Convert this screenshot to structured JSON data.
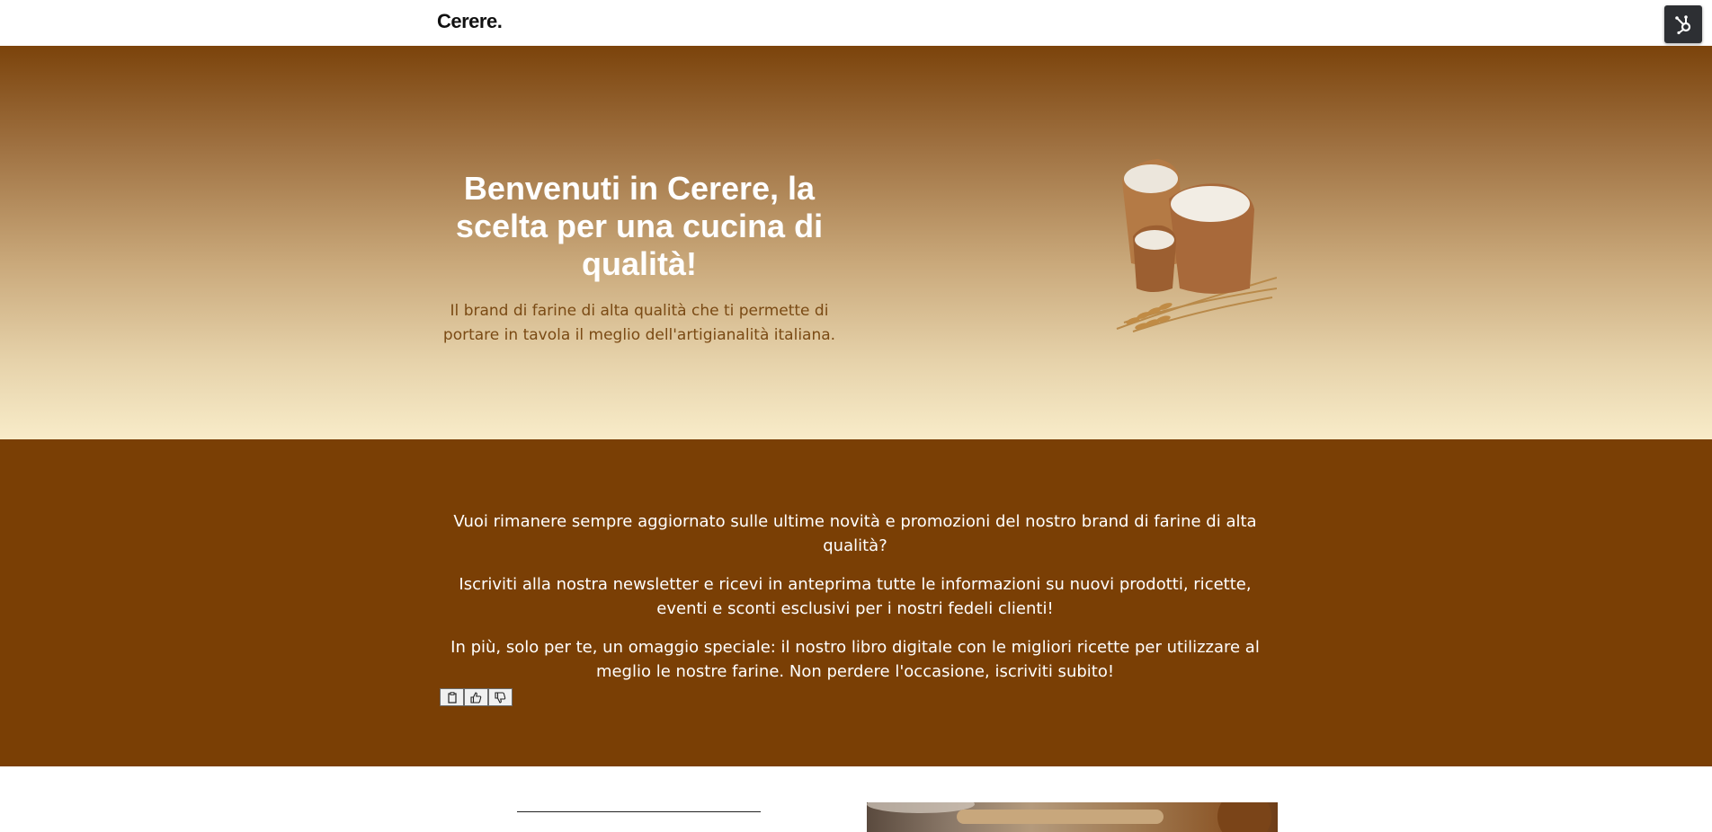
{
  "header": {
    "logo": "Cerere.",
    "hubspot_icon": "hubspot-sprocket-icon"
  },
  "hero": {
    "title": "Benvenuti in Cerere, la scelta per una cucina di qualità!",
    "subtitle": "Il brand di farine di alta qualità che ti permette di portare in tavola il meglio dell'artigianalità italiana.",
    "image_icon": "flour-sacks-wheat-image"
  },
  "newsletter": {
    "paragraph1": "Vuoi rimanere sempre aggiornato sulle ultime novità e promozioni del nostro brand di farine di alta qualità?",
    "paragraph2": "Iscriviti alla nostra newsletter e ricevi in anteprima tutte le informazioni su nuovi prodotti, ricette, eventi e sconti esclusivi per i nostri fedeli clienti!",
    "paragraph3": "In più, solo per te, un omaggio speciale: il nostro libro digitale con le migliori ricette per utilizzare al meglio le nostre farine. Non perdere l'occasione, iscriviti subito!",
    "feedback_icons": [
      "clipboard-icon",
      "thumbs-up-icon",
      "thumbs-down-icon"
    ]
  },
  "colors": {
    "brown": "#7a3f05",
    "hero_top": "#7b430b",
    "hero_bottom": "#f8ecc9",
    "subtitle": "#7a4a14"
  }
}
